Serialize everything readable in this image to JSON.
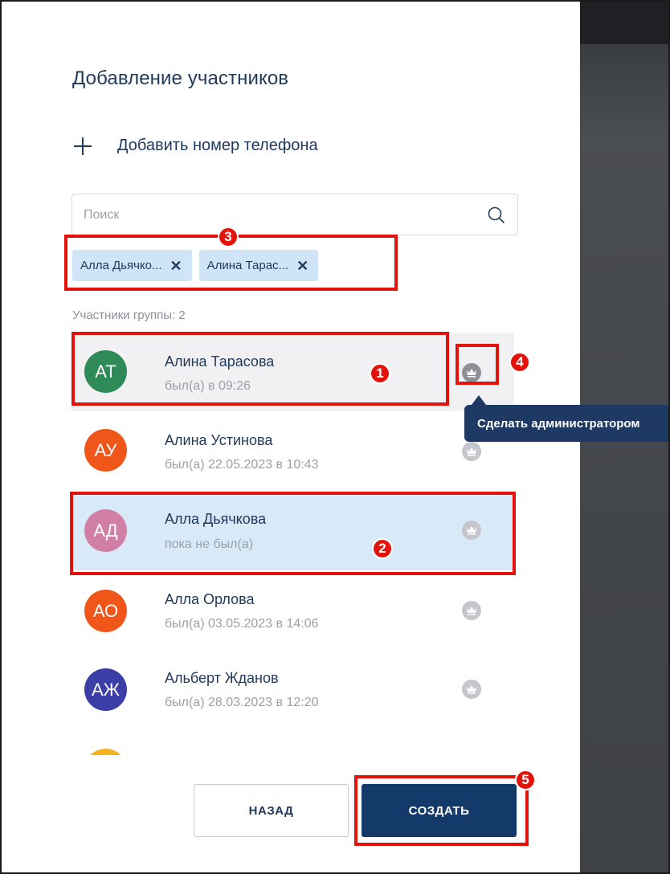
{
  "dialog": {
    "title": "Добавление участников",
    "add_phone_label": "Добавить номер телефона"
  },
  "search": {
    "placeholder": "Поиск",
    "value": ""
  },
  "chips": [
    {
      "label": "Алла Дьячко..."
    },
    {
      "label": "Алина Тарас..."
    }
  ],
  "members": {
    "count_label": "Участники группы: 2",
    "items": [
      {
        "initials": "АТ",
        "name": "Алина Тарасова",
        "status": "был(а) в 09:26",
        "avatar_color": "#2e8b57",
        "state": "hover",
        "admin": true
      },
      {
        "initials": "АУ",
        "name": "Алина Устинова",
        "status": "был(а) 22.05.2023 в 10:43",
        "avatar_color": "#f0561a",
        "state": "normal",
        "admin": false
      },
      {
        "initials": "АД",
        "name": "Алла Дьячкова",
        "status": "пока не был(а)",
        "avatar_color": "#d27fa6",
        "state": "selected",
        "admin": false
      },
      {
        "initials": "АО",
        "name": "Алла Орлова",
        "status": "был(а) 03.05.2023 в 14:06",
        "avatar_color": "#f0561a",
        "state": "normal",
        "admin": false
      },
      {
        "initials": "АЖ",
        "name": "Альберт Жданов",
        "status": "был(а) 28.03.2023 в 12:20",
        "avatar_color": "#3b3ea6",
        "state": "normal",
        "admin": false
      },
      {
        "initials": "",
        "name": "",
        "status": "",
        "avatar_color": "#f5b41f",
        "state": "normal",
        "admin": false
      }
    ]
  },
  "tooltip": {
    "text": "Сделать администратором"
  },
  "buttons": {
    "back_label": "НАЗАД",
    "create_label": "СОЗДАТЬ"
  },
  "annotations": {
    "badges": [
      "1",
      "2",
      "3",
      "4",
      "5"
    ],
    "color": "#e3120b"
  },
  "icons": {
    "add": "plus-icon",
    "search": "search-icon",
    "chip_remove": "close-icon",
    "admin": "crown-icon"
  }
}
